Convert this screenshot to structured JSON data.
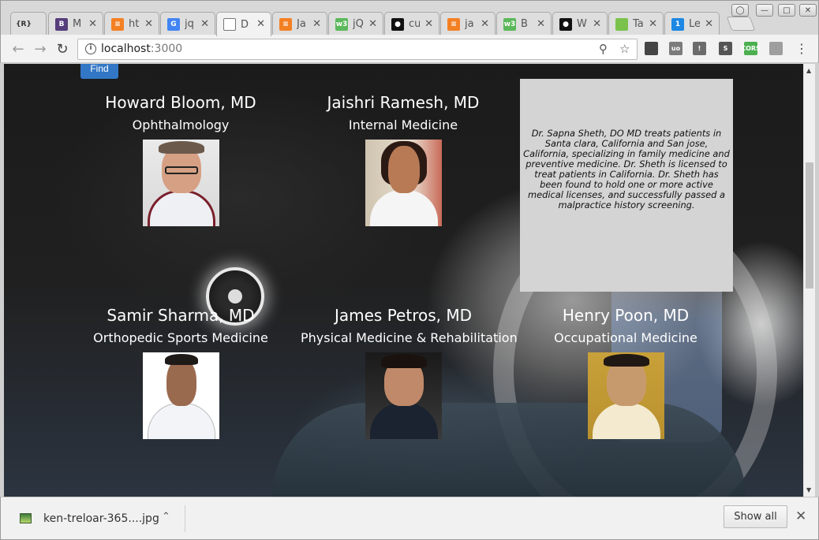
{
  "tabs": [
    {
      "title": "{R}",
      "icon": "braces-icon",
      "favicon_text": "{R}",
      "color": "#dedede",
      "fg": "#333"
    },
    {
      "title": "M",
      "icon": "bootstrap-icon",
      "favicon_text": "B",
      "color": "#563d7c"
    },
    {
      "title": "ht",
      "icon": "stackoverflow-icon",
      "favicon_text": "≡",
      "color": "#f48024"
    },
    {
      "title": "jq",
      "icon": "google-icon",
      "favicon_text": "G",
      "color": "#4285f4"
    },
    {
      "title": "D",
      "icon": "document-icon",
      "favicon_text": "",
      "color": "#ffffff",
      "active": true
    },
    {
      "title": "Ja",
      "icon": "stackoverflow-icon",
      "favicon_text": "≡",
      "color": "#f48024"
    },
    {
      "title": "jQ",
      "icon": "w3schools-icon",
      "favicon_text": "w3",
      "color": "#5bb85b"
    },
    {
      "title": "cu",
      "icon": "github-icon",
      "favicon_text": "●",
      "color": "#111111"
    },
    {
      "title": "ja",
      "icon": "stackoverflow-icon",
      "favicon_text": "≡",
      "color": "#f48024"
    },
    {
      "title": "B",
      "icon": "w3schools-icon",
      "favicon_text": "w3",
      "color": "#5bb85b"
    },
    {
      "title": "W",
      "icon": "github-icon",
      "favicon_text": "●",
      "color": "#111111"
    },
    {
      "title": "Ta",
      "icon": "page-icon",
      "favicon_text": "",
      "color": "#7ac24c"
    },
    {
      "title": "Le",
      "icon": "number-one-icon",
      "favicon_text": "1",
      "color": "#1e88e5"
    }
  ],
  "toolbar": {
    "url_host": "localhost",
    "url_port": ":3000"
  },
  "extensions": [
    {
      "icon": "bird-extension-icon",
      "text": "",
      "color": "#444444"
    },
    {
      "icon": "ublock-icon",
      "text": "uo",
      "color": "#7b7b7b"
    },
    {
      "icon": "tag-extension-icon",
      "text": "!",
      "color": "#6b6b6b"
    },
    {
      "icon": "s-extension-icon",
      "text": "S",
      "color": "#555555"
    },
    {
      "icon": "cors-extension-icon",
      "text": "CORS",
      "color": "#4caf50"
    },
    {
      "icon": "screen-extension-icon",
      "text": "",
      "color": "#9e9e9e"
    }
  ],
  "page": {
    "find_label": "Find",
    "doctors": [
      {
        "name": "Howard Bloom, MD",
        "specialty": "Ophthalmology"
      },
      {
        "name": "Jaishri Ramesh, MD",
        "specialty": "Internal Medicine"
      },
      {
        "name": "Samir Sharma, MD",
        "specialty": "Orthopedic Sports Medicine"
      },
      {
        "name": "James Petros, MD",
        "specialty": "Physical Medicine & Rehabilitation"
      },
      {
        "name": "Henry Poon, MD",
        "specialty": "Occupational Medicine"
      }
    ],
    "bio": "Dr. Sapna Sheth, DO MD treats patients in Santa clara, California and San jose, California, specializing in family medicine and preventive medicine. Dr. Sheth is licensed to treat patients in California. Dr. Sheth has been found to hold one or more active medical licenses, and successfully passed a malpractice history screening."
  },
  "downloads": {
    "filename": "ken-treloar-365....jpg",
    "show_all": "Show all"
  }
}
